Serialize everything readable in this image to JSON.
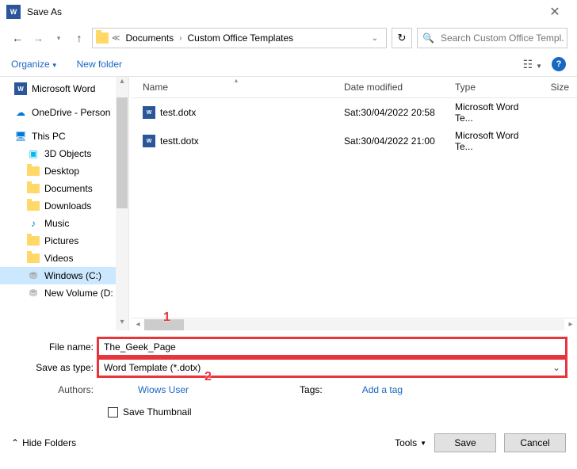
{
  "window": {
    "title": "Save As"
  },
  "breadcrumb": {
    "seg1": "Documents",
    "seg2": "Custom Office Templates"
  },
  "search": {
    "placeholder": "Search Custom Office Templ..."
  },
  "toolbar": {
    "organize": "Organize",
    "newfolder": "New folder"
  },
  "columns": {
    "name": "Name",
    "date": "Date modified",
    "type": "Type",
    "size": "Size"
  },
  "files": [
    {
      "name": "test.dotx",
      "date": "Sat:30/04/2022 20:58",
      "type": "Microsoft Word Te..."
    },
    {
      "name": "testt.dotx",
      "date": "Sat:30/04/2022 21:00",
      "type": "Microsoft Word Te..."
    }
  ],
  "sidebar": {
    "items": [
      {
        "label": "Microsoft Word",
        "icon": "word"
      },
      {
        "label": "OneDrive - Person",
        "icon": "cloud"
      },
      {
        "label": "This PC",
        "icon": "pc"
      },
      {
        "label": "3D Objects",
        "icon": "3d",
        "indent": true
      },
      {
        "label": "Desktop",
        "icon": "folder",
        "indent": true
      },
      {
        "label": "Documents",
        "icon": "folder",
        "indent": true
      },
      {
        "label": "Downloads",
        "icon": "folder",
        "indent": true
      },
      {
        "label": "Music",
        "icon": "music",
        "indent": true
      },
      {
        "label": "Pictures",
        "icon": "folder",
        "indent": true
      },
      {
        "label": "Videos",
        "icon": "folder",
        "indent": true
      },
      {
        "label": "Windows (C:)",
        "icon": "drive",
        "indent": true,
        "selected": true
      },
      {
        "label": "New Volume (D:",
        "icon": "drive",
        "indent": true
      }
    ]
  },
  "form": {
    "filename_label": "File name:",
    "filename_value": "The_Geek_Page",
    "savetype_label": "Save as type:",
    "savetype_value": "Word Template (*.dotx)",
    "authors_label": "Authors:",
    "authors_value": "Wiows User",
    "tags_label": "Tags:",
    "tags_value": "Add a tag",
    "save_thumb": "Save Thumbnail"
  },
  "footer": {
    "hide": "Hide Folders",
    "tools": "Tools",
    "save": "Save",
    "cancel": "Cancel"
  },
  "annot": {
    "one": "1",
    "two": "2"
  }
}
